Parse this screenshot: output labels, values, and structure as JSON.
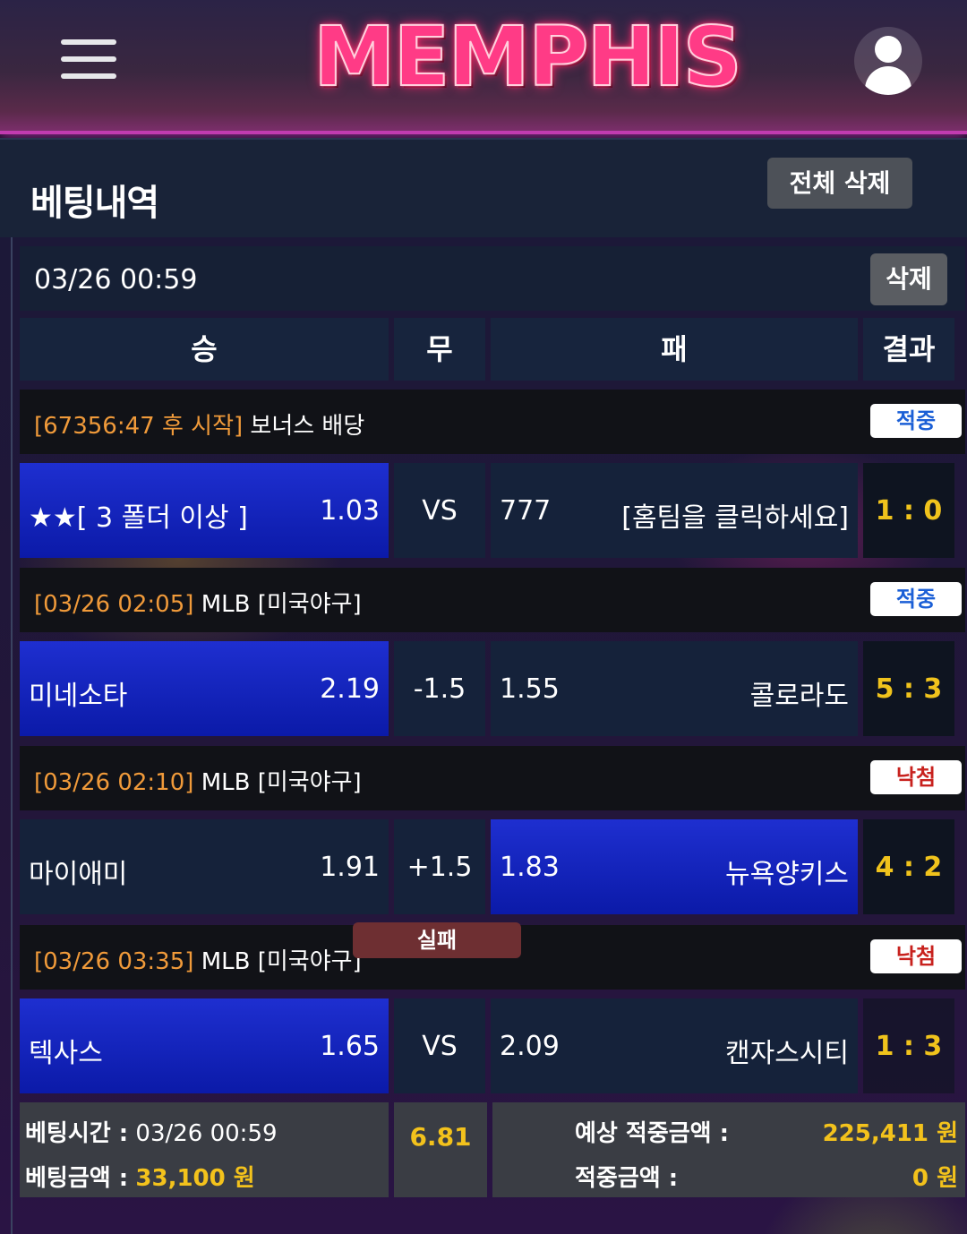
{
  "app": {
    "logo": "MEMPHIS"
  },
  "header": {
    "menu_icon": "hamburger-icon",
    "user_icon": "user-icon"
  },
  "title_bar": {
    "title": "베팅내역",
    "delete_all_label": "전체 삭제"
  },
  "bet": {
    "datetime": "03/26 00:59",
    "delete_label": "삭제",
    "columns": [
      "승",
      "무",
      "패",
      "결과"
    ],
    "games": [
      {
        "time": "[67356:47 후 시작]",
        "league": "보너스 배당",
        "status": "적중",
        "status_type": "win",
        "home": "★★[ 3 폴더 이상 ]",
        "home_odds": "1.03",
        "draw": "VS",
        "away_odds": "777",
        "away": "[홈팀을 클릭하세요]",
        "score": "1 : 0",
        "selected": "home"
      },
      {
        "time": "[03/26 02:05]",
        "league": "MLB [미국야구]",
        "status": "적중",
        "status_type": "win",
        "home": "미네소타",
        "home_odds": "2.19",
        "draw": "-1.5",
        "away_odds": "1.55",
        "away": "콜로라도",
        "score": "5 : 3",
        "selected": "home"
      },
      {
        "time": "[03/26 02:10]",
        "league": "MLB [미국야구]",
        "status": "낙첨",
        "status_type": "lose",
        "home": "마이애미",
        "home_odds": "1.91",
        "draw": "+1.5",
        "away_odds": "1.83",
        "away": "뉴욕양키스",
        "score": "4 : 2",
        "selected": "away"
      },
      {
        "time": "[03/26 03:35]",
        "league": "MLB [미국야구]",
        "status": "낙첨",
        "status_type": "lose",
        "home": "텍사스",
        "home_odds": "1.65",
        "draw": "VS",
        "away_odds": "2.09",
        "away": "캔자스시티",
        "score": "1 : 3",
        "selected": "home"
      }
    ],
    "summary": {
      "bet_time_label": "베팅시간 :",
      "bet_time": "03/26 00:59",
      "bet_amount_label": "베팅금액 :",
      "bet_amount": "33,100 원",
      "total_odds": "6.81",
      "result": "실패",
      "expected_label": "예상 적중금액 :",
      "expected": "225,411 원",
      "won_label": "적중금액 :",
      "won": "0 원"
    }
  },
  "colors": {
    "selected_blue": "#0b1aa8",
    "odds_time_orange": "#f09a3a",
    "score_yellow": "#f0c31c",
    "win_badge_text": "#1b5fd6",
    "lose_badge_text": "#c8221e",
    "fail_badge": "#6e2f32"
  }
}
